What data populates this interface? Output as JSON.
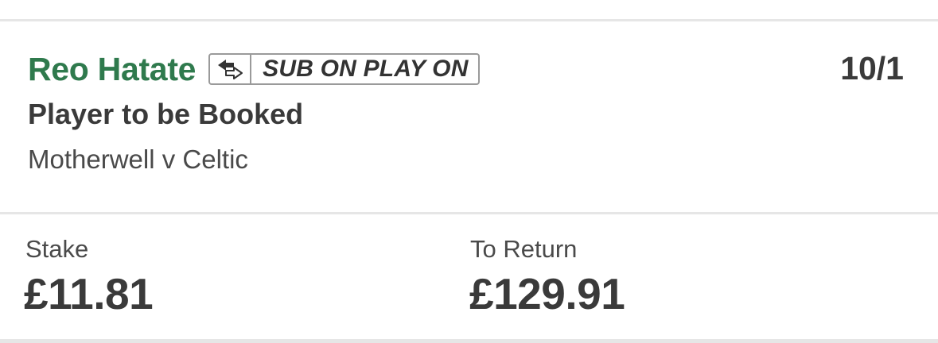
{
  "selection": {
    "player_name": "Reo Hatate",
    "badge": {
      "icon": "swap-arrows-icon",
      "label": "SUB ON PLAY ON"
    },
    "odds": "10/1",
    "market": "Player to be Booked",
    "event": "Motherwell v Celtic"
  },
  "bet": {
    "stake_label": "Stake",
    "stake_value": "£11.81",
    "return_label": "To Return",
    "return_value": "£129.91"
  },
  "colors": {
    "player_name": "#2f7a4d",
    "text": "#3a3a3a",
    "badge_border": "#9a9a9a",
    "divider": "#e6e6e6"
  }
}
